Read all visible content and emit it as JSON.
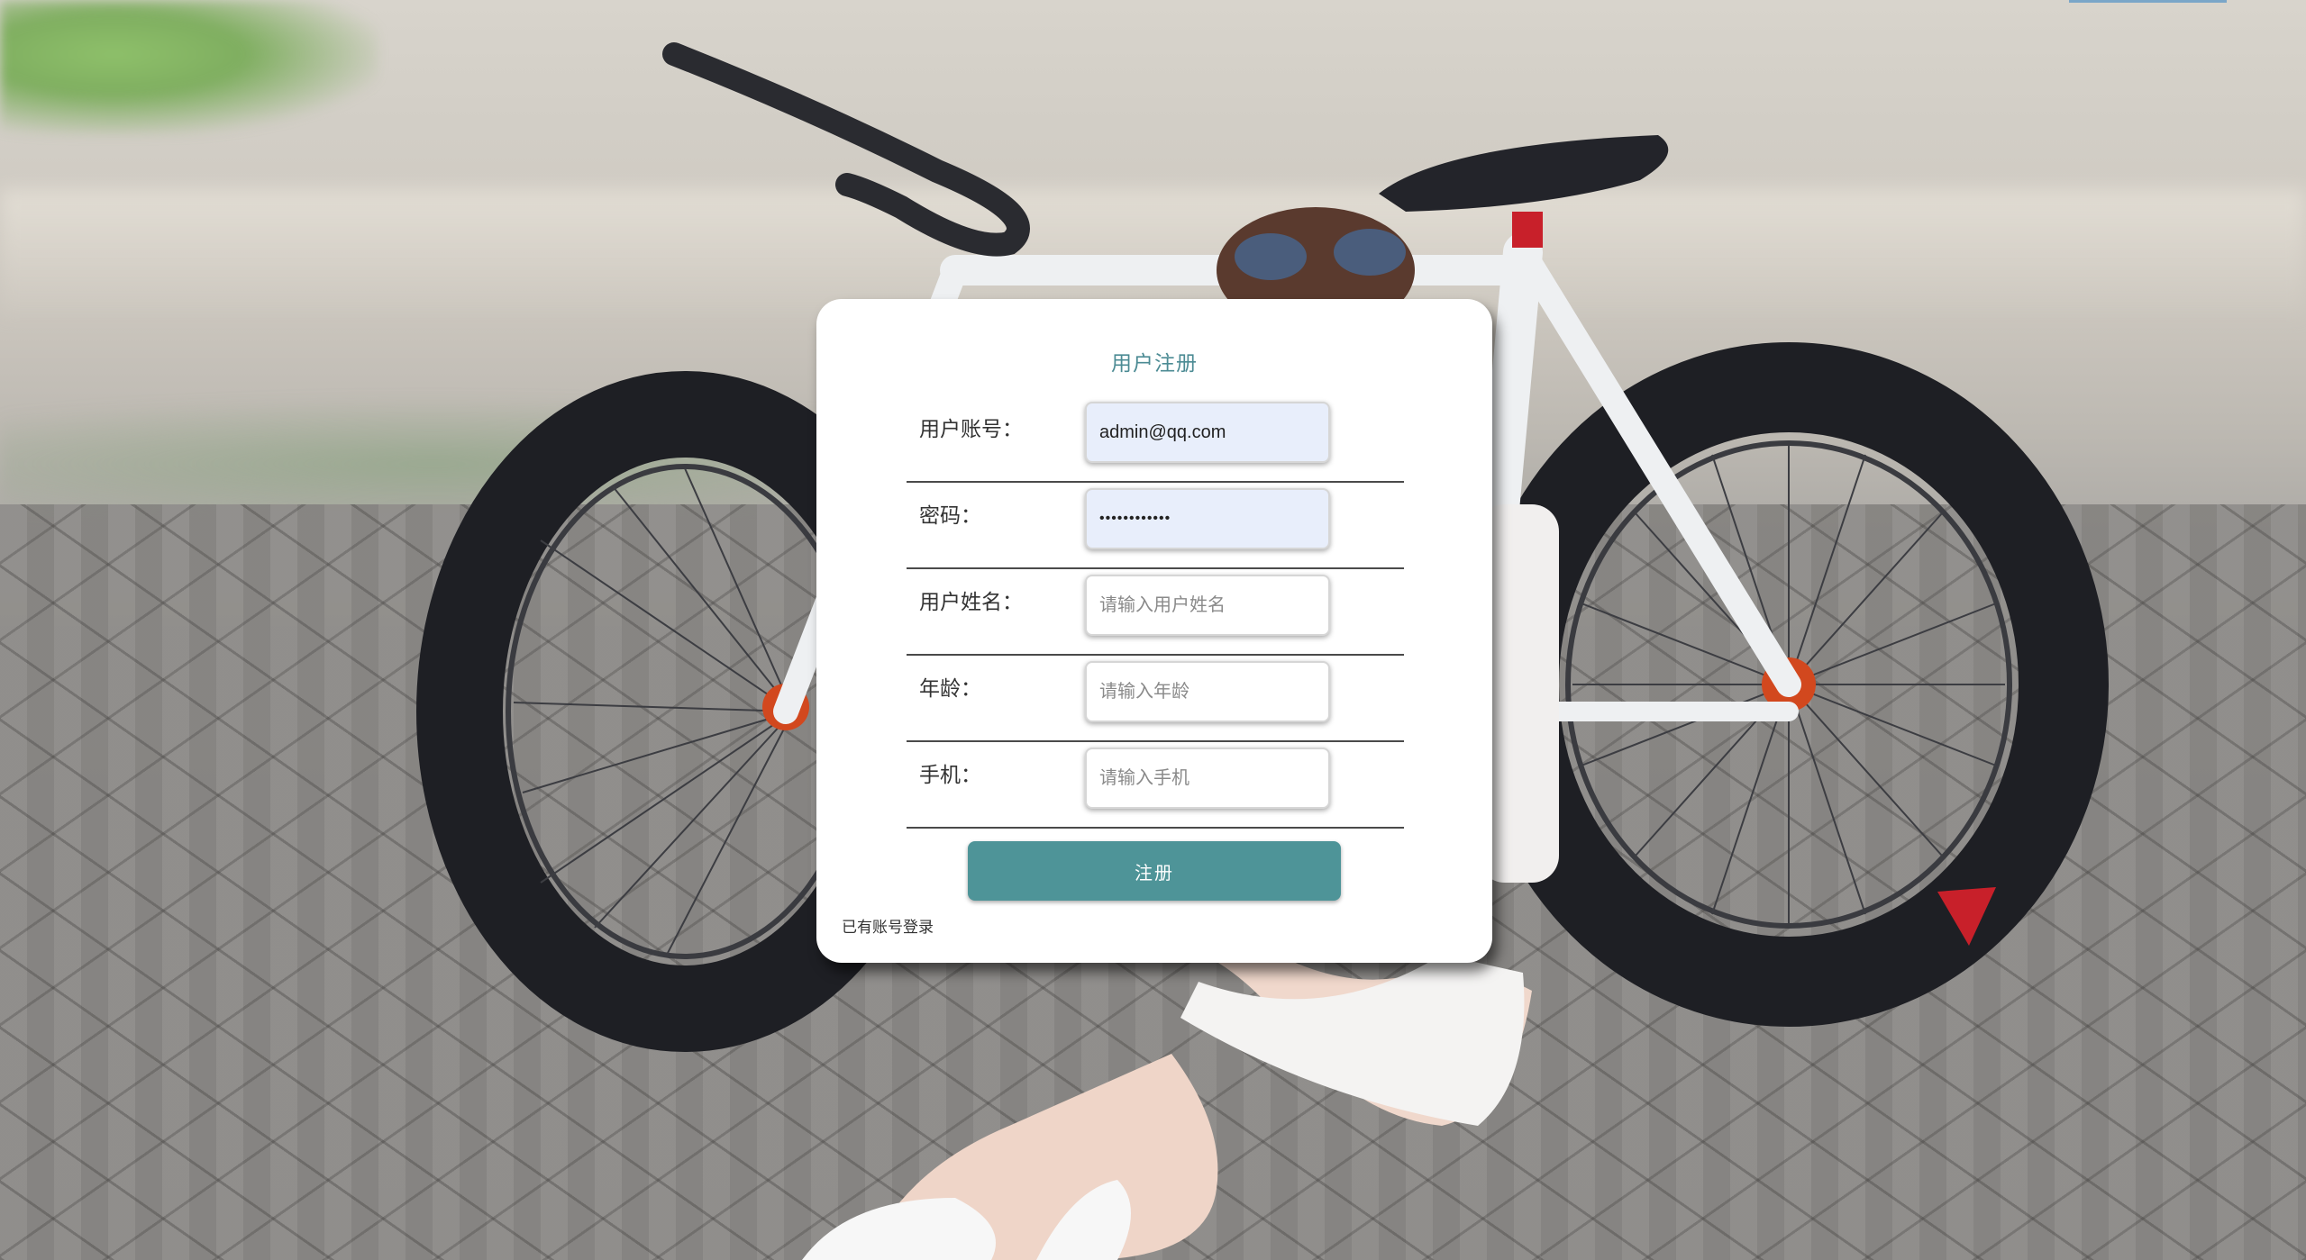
{
  "page": {
    "title": "用户注册"
  },
  "form": {
    "fields": [
      {
        "label": "用户账号：",
        "value": "admin@qq.com",
        "placeholder": "",
        "type": "text"
      },
      {
        "label": "密码：",
        "value": "••••••••••••",
        "placeholder": "",
        "type": "password"
      },
      {
        "label": "用户姓名：",
        "value": "",
        "placeholder": "请输入用户姓名",
        "type": "text"
      },
      {
        "label": "年龄：",
        "value": "",
        "placeholder": "请输入年龄",
        "type": "text"
      },
      {
        "label": "手机：",
        "value": "",
        "placeholder": "请输入手机",
        "type": "text"
      }
    ],
    "submit_label": "注册",
    "login_link": "已有账号登录"
  },
  "colors": {
    "accent": "#4e9498",
    "title": "#4c8b94",
    "filled_input_bg": "#e8eefb"
  }
}
